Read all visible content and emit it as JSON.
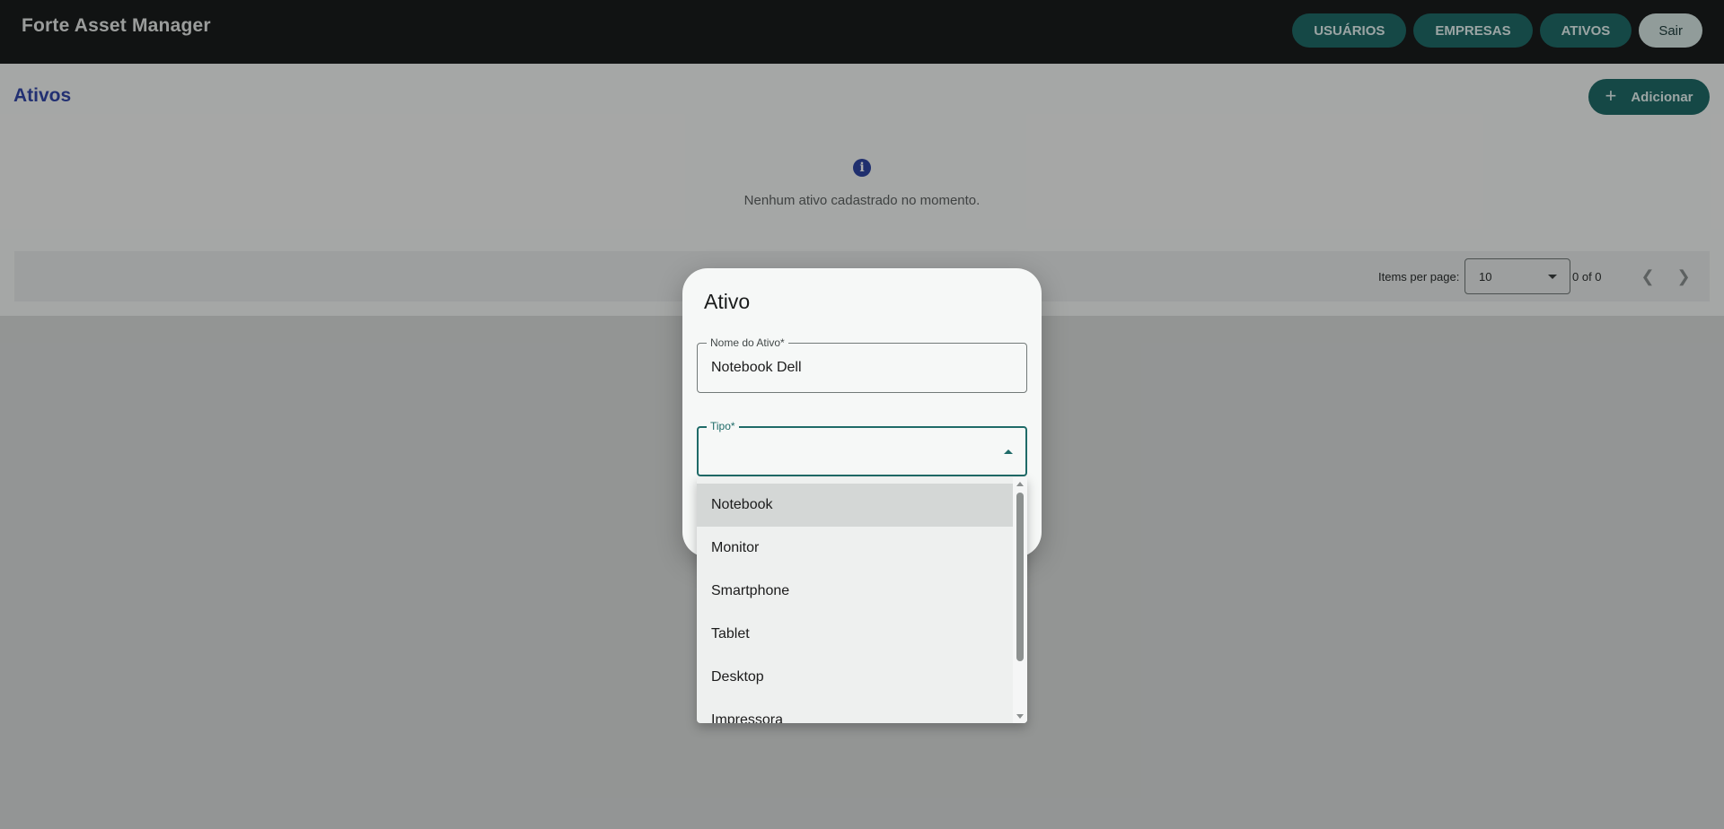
{
  "app": {
    "title": "Forte Asset Manager"
  },
  "nav": {
    "users": "USUÁRIOS",
    "companies": "EMPRESAS",
    "assets": "ATIVOS",
    "exit": "Sair"
  },
  "page": {
    "title": "Ativos",
    "add_label": "Adicionar",
    "empty_message": "Nenhum ativo cadastrado no momento."
  },
  "paginator": {
    "items_per_page_label": "Items per page:",
    "items_per_page_value": "10",
    "range_label": "0 of 0"
  },
  "dialog": {
    "title": "Ativo",
    "name_field": {
      "label": "Nome do Ativo*",
      "value": "Notebook Dell"
    },
    "type_field": {
      "label": "Tipo*",
      "value": ""
    }
  },
  "dropdown": {
    "options": [
      "Notebook",
      "Monitor",
      "Smartphone",
      "Tablet",
      "Desktop",
      "Impressora"
    ],
    "highlighted_index": 0
  },
  "colors": {
    "topbar": "#1a1c1c",
    "primary": "#1f6b68",
    "title_blue": "#3347a8",
    "info_icon": "#2f46a3"
  }
}
